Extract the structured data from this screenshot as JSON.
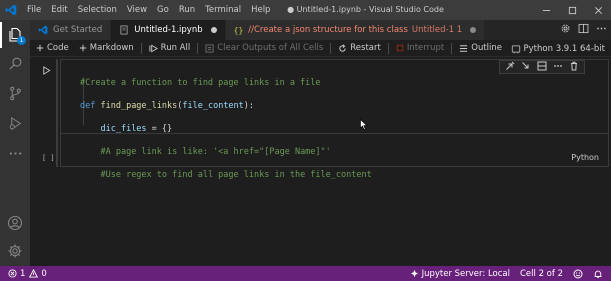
{
  "titlebar": {
    "menu": [
      "File",
      "Edit",
      "Selection",
      "View",
      "Go",
      "Run",
      "Terminal",
      "Help"
    ],
    "title": "● Untitled-1.ipynb - Visual Studio Code",
    "logo_icon": "vscode-logo-icon",
    "accent": "#3c3c3c"
  },
  "activitybar": {
    "explorer_badge": "1",
    "icons": [
      "explorer-icon",
      "search-icon",
      "source-control-icon",
      "run-debug-icon",
      "more-icon",
      "account-icon",
      "settings-icon"
    ]
  },
  "tabs": [
    {
      "label": "Get Started",
      "icon": "vscode-logo-icon"
    },
    {
      "label": "Untitled-1.ipynb",
      "icon": "notebook-icon",
      "active": true
    },
    {
      "label": "//Create a json structure for this class",
      "sublabel": "Untitled-1 1",
      "icon": "braces-icon"
    }
  ],
  "notebook_toolbar": {
    "code": "Code",
    "markdown": "Markdown",
    "run_all": "Run All",
    "clear_outputs": "Clear Outputs of All Cells",
    "restart": "Restart",
    "interrupt": "Interrupt",
    "outline": "Outline",
    "kernel": "Python 3.9.1 64-bit"
  },
  "cell": {
    "execution_count": "[ ]",
    "language": "Python",
    "code_lines": [
      "#Create a function to find page links in a file",
      "def find_page_links(file_content):",
      "    dic_files = {}",
      "    #A page link is like: '<a href=\"[Page Name]\"'",
      "    #Use regex to find all page links in the file_content"
    ]
  },
  "statusbar": {
    "errors": "1",
    "warnings": "0",
    "jupyter_server": "Jupyter Server: Local",
    "cell_position": "Cell 2 of 2",
    "background": "#68217a"
  }
}
